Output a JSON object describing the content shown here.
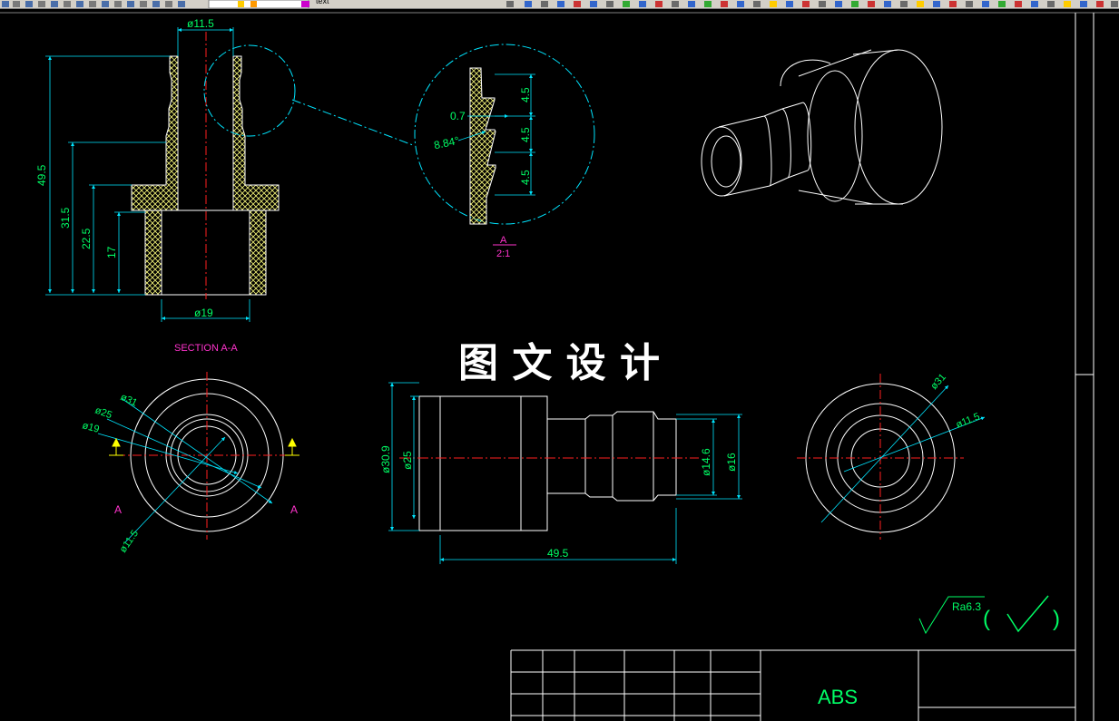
{
  "toolbar": {
    "layer_text": "text"
  },
  "colors": {
    "background": "#000000",
    "outline": "#ffffff",
    "dimension": "#00ff66",
    "dimension_line": "#00e5ff",
    "hatch": "#f5f57a",
    "center_line": "#ff2020",
    "section_label": "#ff33cc",
    "yellow_arrow": "#ffff00"
  },
  "section_view": {
    "dims": {
      "top_diameter": "ø11.5",
      "overall_height": "49.5",
      "height_2": "31.5",
      "height_3": "22.5",
      "height_4": "17",
      "bottom_diameter": "ø19"
    },
    "label": "SECTION A-A"
  },
  "detail_view": {
    "dims": {
      "step_1": "4.5",
      "step_2": "4.5",
      "step_3": "4.5",
      "depth": "0.7",
      "angle": "8.84°"
    },
    "label_letter": "A",
    "label_scale": "2:1"
  },
  "end_view": {
    "dims": {
      "d31": "ø31",
      "d25": "ø25",
      "d19": "ø19",
      "d11_5": "ø11.5"
    },
    "cut_left": "A",
    "cut_right": "A"
  },
  "side_view": {
    "dims": {
      "d30_9": "ø30.9",
      "d25": "ø25",
      "d14_6": "ø14.6",
      "d16": "ø16",
      "length": "49.5"
    }
  },
  "right_view": {
    "dims": {
      "d31": "ø31",
      "d11_5": "ø11.5"
    }
  },
  "watermark": "图 文 设 计",
  "roughness": {
    "value": "Ra6.3",
    "open_paren": "(",
    "close_paren": ")"
  },
  "title_block": {
    "material": "ABS"
  }
}
